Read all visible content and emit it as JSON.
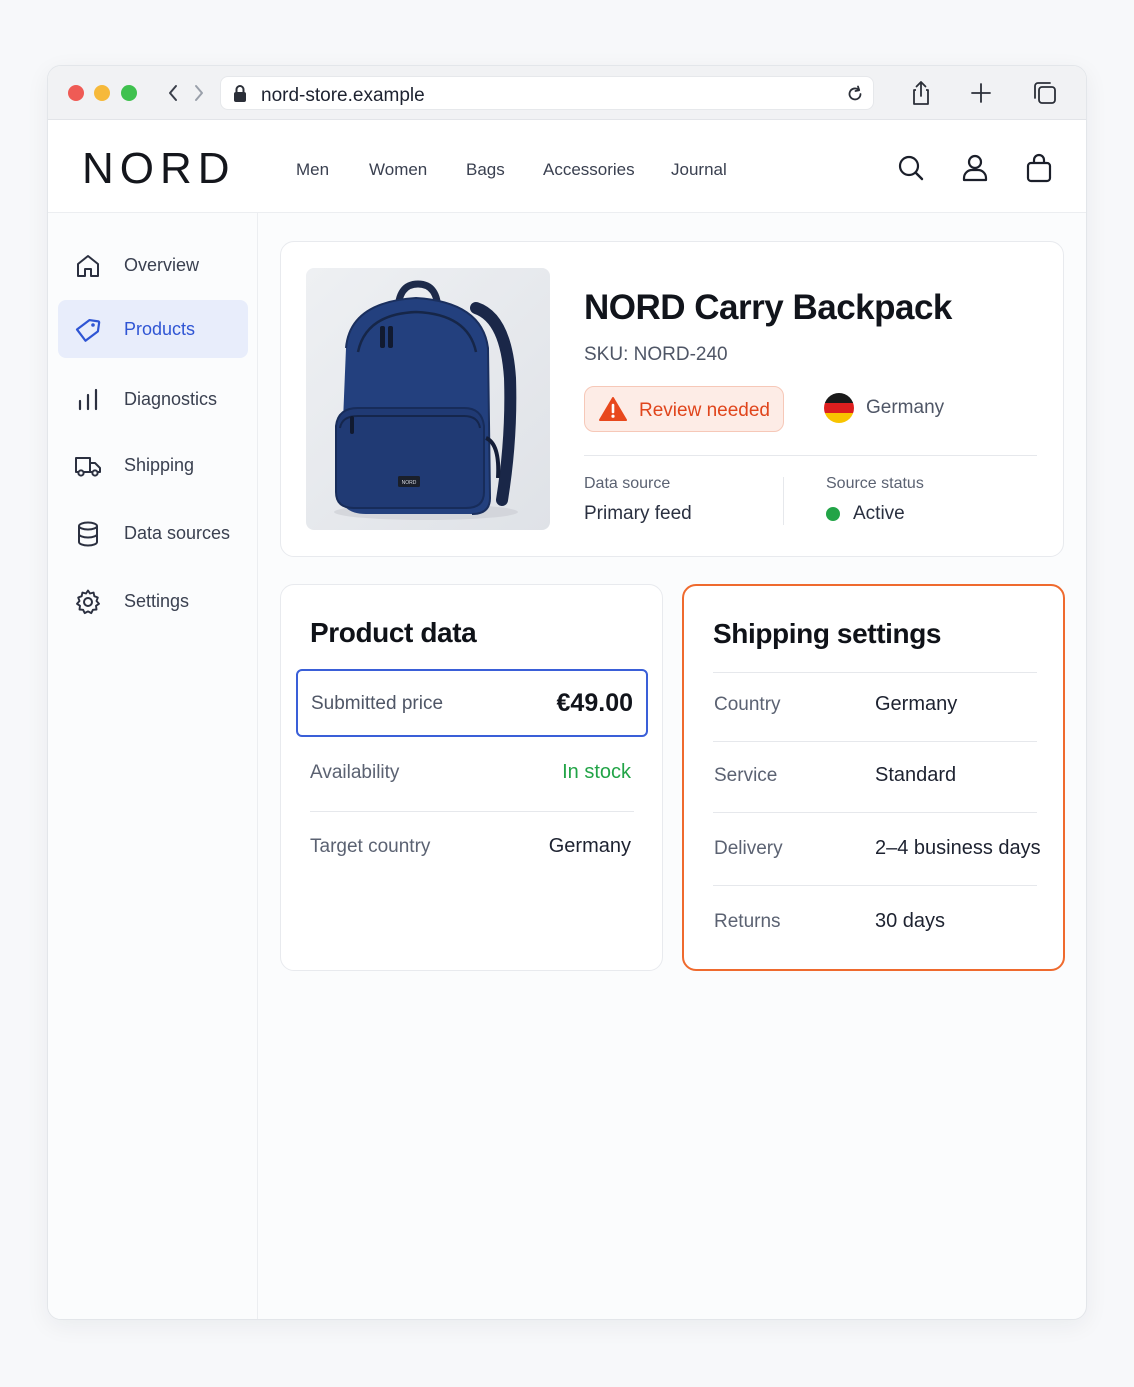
{
  "browser": {
    "url": "nord-store.example"
  },
  "site": {
    "logo": "NORD",
    "nav": [
      "Men",
      "Women",
      "Bags",
      "Accessories",
      "Journal"
    ]
  },
  "sidebar": {
    "items": [
      {
        "label": "Overview",
        "icon": "home-icon"
      },
      {
        "label": "Products",
        "icon": "tag-icon",
        "active": true
      },
      {
        "label": "Diagnostics",
        "icon": "bar-chart-icon"
      },
      {
        "label": "Shipping",
        "icon": "truck-icon"
      },
      {
        "label": "Data sources",
        "icon": "database-icon"
      },
      {
        "label": "Settings",
        "icon": "gear-icon"
      }
    ]
  },
  "product": {
    "title": "NORD Carry Backpack",
    "sku": "SKU: NORD-240",
    "badge": "Review needed",
    "country": "Germany",
    "data_source_label": "Data source",
    "data_source_value": "Primary feed",
    "source_status_label": "Source status",
    "source_status_value": "Active",
    "image_brand_text": "NORD"
  },
  "product_data": {
    "title": "Product data",
    "submitted_price_label": "Submitted price",
    "submitted_price_value": "€49.00",
    "availability_label": "Availability",
    "availability_value": "In stock",
    "target_country_label": "Target country",
    "target_country_value": "Germany"
  },
  "shipping_settings": {
    "title": "Shipping settings",
    "rows": [
      {
        "label": "Country",
        "value": "Germany"
      },
      {
        "label": "Service",
        "value": "Standard"
      },
      {
        "label": "Delivery",
        "value": "2–4 business days"
      },
      {
        "label": "Returns",
        "value": "30 days"
      }
    ]
  },
  "colors": {
    "accent": "#2f55d4",
    "warning": "#e0451c",
    "success": "#22a447",
    "highlight_border": "#ef6a2e"
  }
}
